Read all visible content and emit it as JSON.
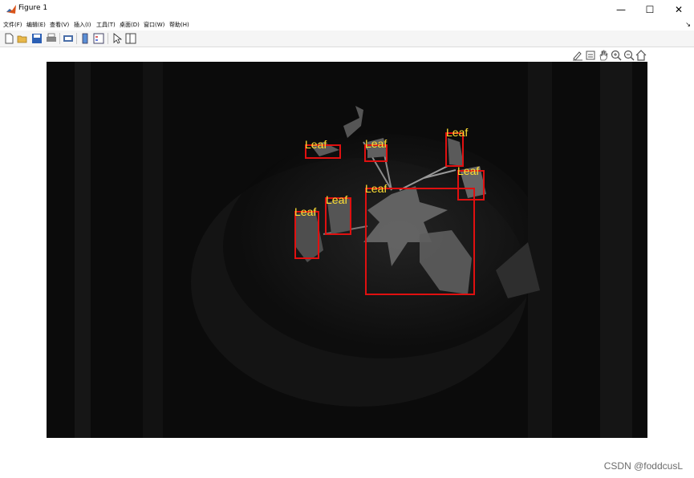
{
  "window": {
    "title": "Figure 1",
    "minimize_glyph": "—",
    "maximize_glyph": "☐",
    "close_glyph": "✕"
  },
  "menu": {
    "items": [
      {
        "label": "文件(F)"
      },
      {
        "label": "编辑(E)"
      },
      {
        "label": "查看(V)"
      },
      {
        "label": "插入(I)"
      },
      {
        "label": "工具(T)"
      },
      {
        "label": "桌面(D)"
      },
      {
        "label": "窗口(W)"
      },
      {
        "label": "帮助(H)"
      }
    ],
    "overflow_glyph": "↘"
  },
  "toolbar": {
    "icons": [
      "new-figure-icon",
      "open-file-icon",
      "save-icon",
      "print-icon",
      "print-preview-icon",
      "colorbar-icon",
      "legend-icon",
      "pointer-icon",
      "property-editor-icon"
    ]
  },
  "axes_toolbar": {
    "icons": [
      "brush-icon",
      "data-tips-icon",
      "pan-icon",
      "zoom-in-icon",
      "zoom-out-icon",
      "home-icon"
    ]
  },
  "detections": [
    {
      "label": "Leaf"
    },
    {
      "label": "Leaf"
    },
    {
      "label": "Leaf"
    },
    {
      "label": "Leaf"
    },
    {
      "label": "Leaf"
    },
    {
      "label": "Leaf"
    },
    {
      "label": "Leaf"
    }
  ],
  "colors": {
    "box": "#e01010",
    "label": "#ffe033",
    "background": "#0a0a0a"
  },
  "watermark": "CSDN @foddcusL"
}
